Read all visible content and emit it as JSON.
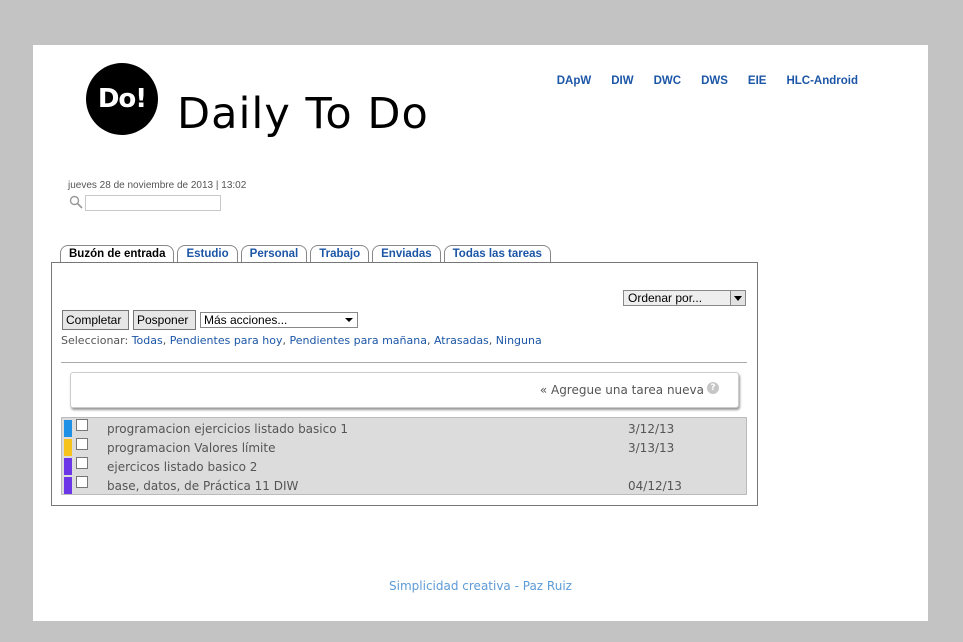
{
  "logo": {
    "text": "Do!"
  },
  "app_title": "Daily To Do",
  "nav": [
    "DApW",
    "DIW",
    "DWC",
    "DWS",
    "EIE",
    "HLC-Android"
  ],
  "datetime": "jueves 28 de noviembre de 2013 | 13:02",
  "search": {
    "placeholder": "",
    "value": "",
    "icon": "search-icon"
  },
  "tabs": [
    {
      "label": "Buzón de entrada",
      "active": true
    },
    {
      "label": "Estudio"
    },
    {
      "label": "Personal"
    },
    {
      "label": "Trabajo"
    },
    {
      "label": "Enviadas"
    },
    {
      "label": "Todas las tareas"
    }
  ],
  "toolbar": {
    "sort_label": "Ordenar por...",
    "complete_label": "Completar",
    "postpone_label": "Posponer",
    "more_actions_label": "Más acciones..."
  },
  "select": {
    "prefix": "Seleccionar: ",
    "options": [
      "Todas",
      "Pendientes para hoy",
      "Pendientes para mañana",
      "Atrasadas",
      "Ninguna"
    ]
  },
  "add_task": "« Agregue una tarea nueva",
  "tasks": [
    {
      "title": "programacion ejercicios listado basico 1",
      "date": "3/12/13",
      "color": "#1e90e6"
    },
    {
      "title": "programacion Valores límite",
      "date": "3/13/13",
      "color": "#f6c21c"
    },
    {
      "title": "ejercicos listado basico 2",
      "date": "",
      "color": "#6b36e8"
    },
    {
      "title": "base, datos, de Práctica 11 DIW",
      "date": "04/12/13",
      "color": "#6b36e8"
    }
  ],
  "footer": "Simplicidad creativa - Paz Ruiz",
  "colors": {
    "link": "#1c56a6",
    "footer": "#5d9bd6",
    "frame": "#c3c3c3"
  }
}
